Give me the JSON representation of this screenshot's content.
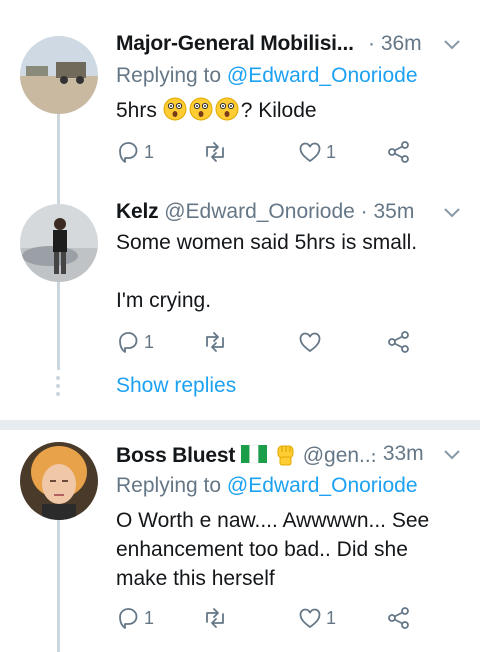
{
  "tweets": [
    {
      "name": "Major-General Mobilisi...",
      "time": "· 36m",
      "replying_prefix": "Replying to",
      "replying_handle": "@Edward_Onoriode",
      "text_before": "5hrs",
      "text_after": "? Kilode",
      "replies": "1",
      "likes": "1"
    },
    {
      "name": "Kelz",
      "handle": "@Edward_Onoriode",
      "time": "· 35m",
      "text_line1": "Some women said 5hrs is small.",
      "text_line2": "I'm crying.",
      "replies": "1"
    },
    {
      "name": "Boss Bluest",
      "handle": "@gen...",
      "time": "· 33m",
      "replying_prefix": "Replying to",
      "replying_handle": "@Edward_Onoriode",
      "text": "O Worth e naw.... Awwwwn... See enhancement too bad.. Did she make this herself",
      "replies": "1",
      "likes": "1"
    }
  ],
  "show_replies": "Show replies",
  "colors": {
    "link": "#1da1f2",
    "muted": "#657786",
    "thread_line": "#ccd6dd",
    "divider": "#e6ecf0"
  },
  "icons": [
    "reply-icon",
    "retweet-icon",
    "like-icon",
    "share-icon",
    "chevron-down-icon",
    "astonished-face-emoji",
    "nigeria-flag-emoji",
    "raised-fist-emoji"
  ]
}
